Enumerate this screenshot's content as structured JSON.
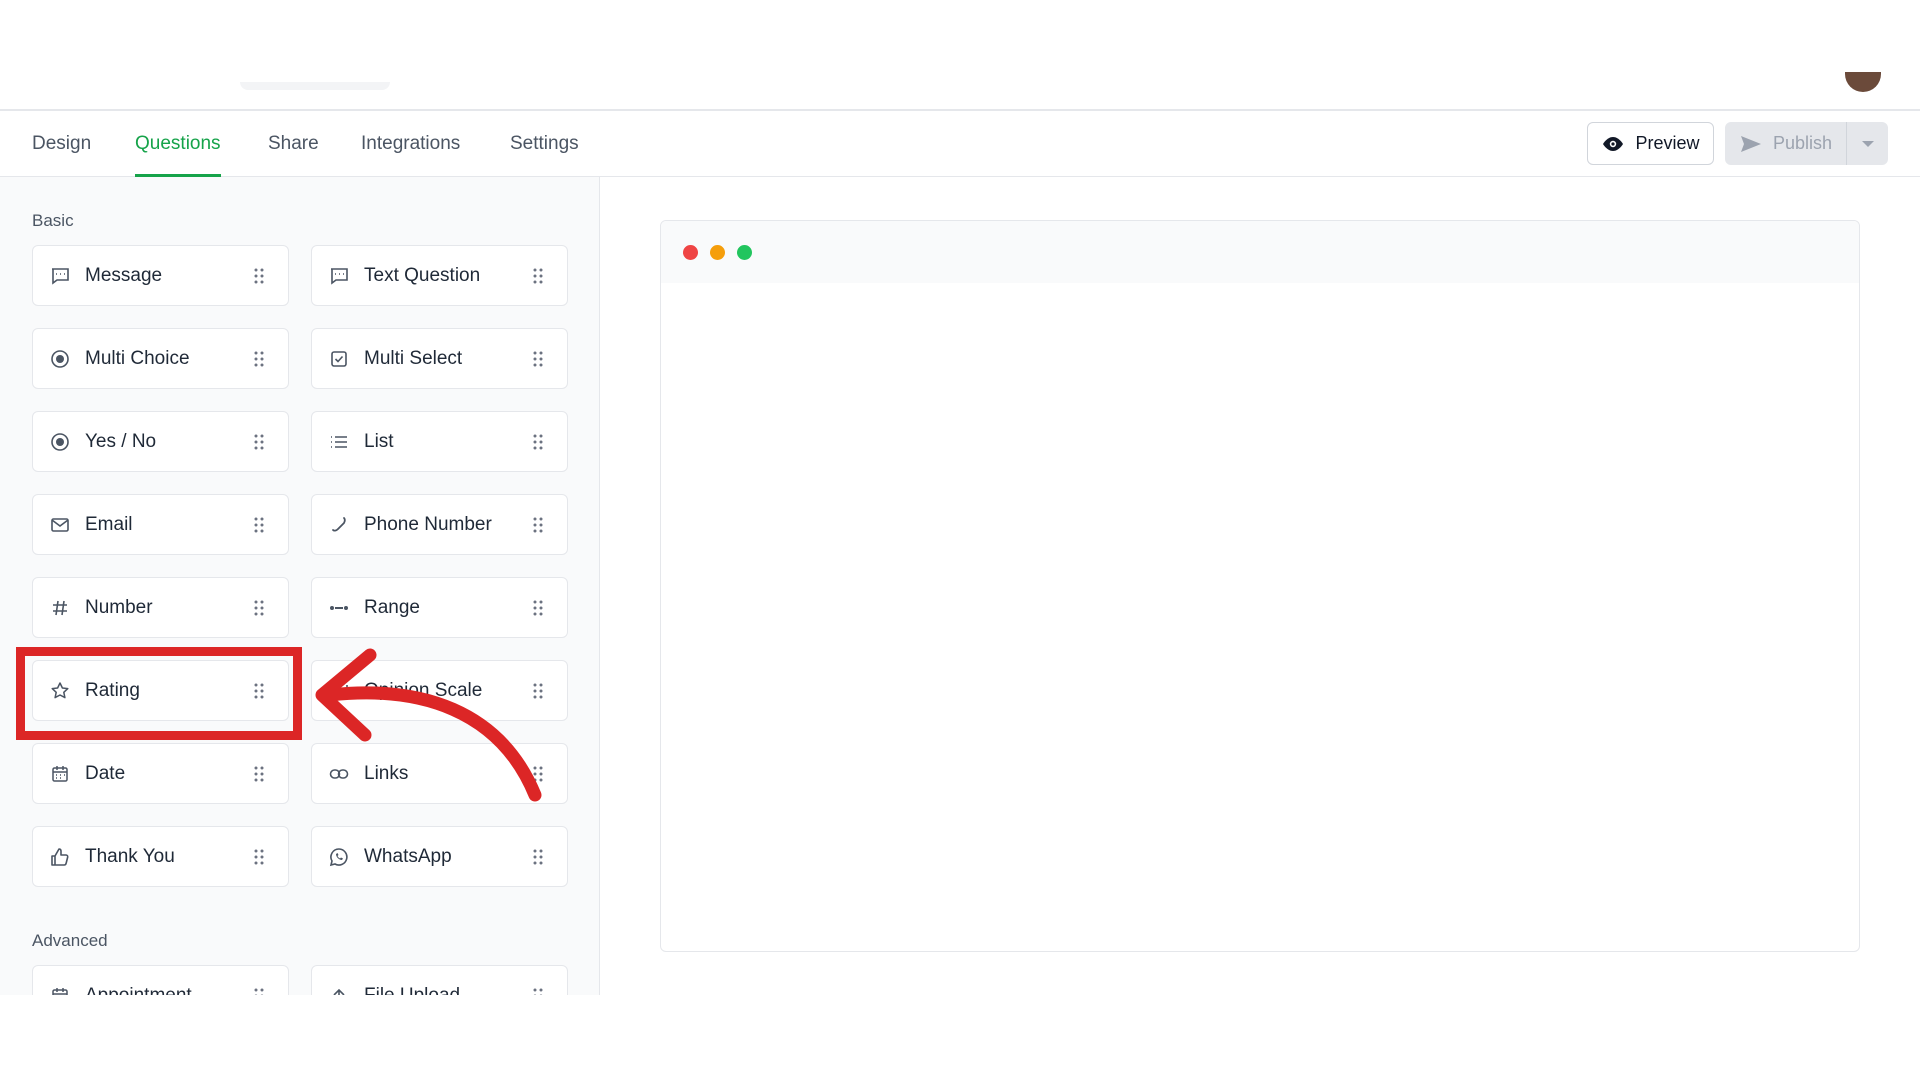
{
  "tabs": [
    {
      "label": "Design"
    },
    {
      "label": "Questions"
    },
    {
      "label": "Share"
    },
    {
      "label": "Integrations"
    },
    {
      "label": "Settings"
    }
  ],
  "active_tab": "Questions",
  "toolbar": {
    "preview_label": "Preview",
    "publish_label": "Publish"
  },
  "sidebar": {
    "basic_label": "Basic",
    "advanced_label": "Advanced",
    "basic_items": [
      {
        "label": "Message",
        "icon": "message-icon"
      },
      {
        "label": "Text Question",
        "icon": "message-icon"
      },
      {
        "label": "Multi Choice",
        "icon": "radio-icon"
      },
      {
        "label": "Multi Select",
        "icon": "checkbox-icon"
      },
      {
        "label": "Yes / No",
        "icon": "radio-icon"
      },
      {
        "label": "List",
        "icon": "list-icon"
      },
      {
        "label": "Email",
        "icon": "mail-icon"
      },
      {
        "label": "Phone Number",
        "icon": "phone-icon"
      },
      {
        "label": "Number",
        "icon": "hash-icon"
      },
      {
        "label": "Range",
        "icon": "range-icon"
      },
      {
        "label": "Rating",
        "icon": "star-icon"
      },
      {
        "label": "Opinion Scale",
        "icon": "scale-icon"
      },
      {
        "label": "Date",
        "icon": "calendar-icon"
      },
      {
        "label": "Links",
        "icon": "link-icon"
      },
      {
        "label": "Thank You",
        "icon": "thumbs-up-icon"
      },
      {
        "label": "WhatsApp",
        "icon": "whatsapp-icon"
      }
    ],
    "advanced_items": [
      {
        "label": "Appointment",
        "icon": "calendar-icon"
      },
      {
        "label": "File Upload",
        "icon": "upload-icon"
      }
    ]
  },
  "window_dots": [
    "#ef4444",
    "#f59e0b",
    "#22c55e"
  ],
  "colors": {
    "accent": "#16a34a",
    "annotation": "#dc2626"
  }
}
